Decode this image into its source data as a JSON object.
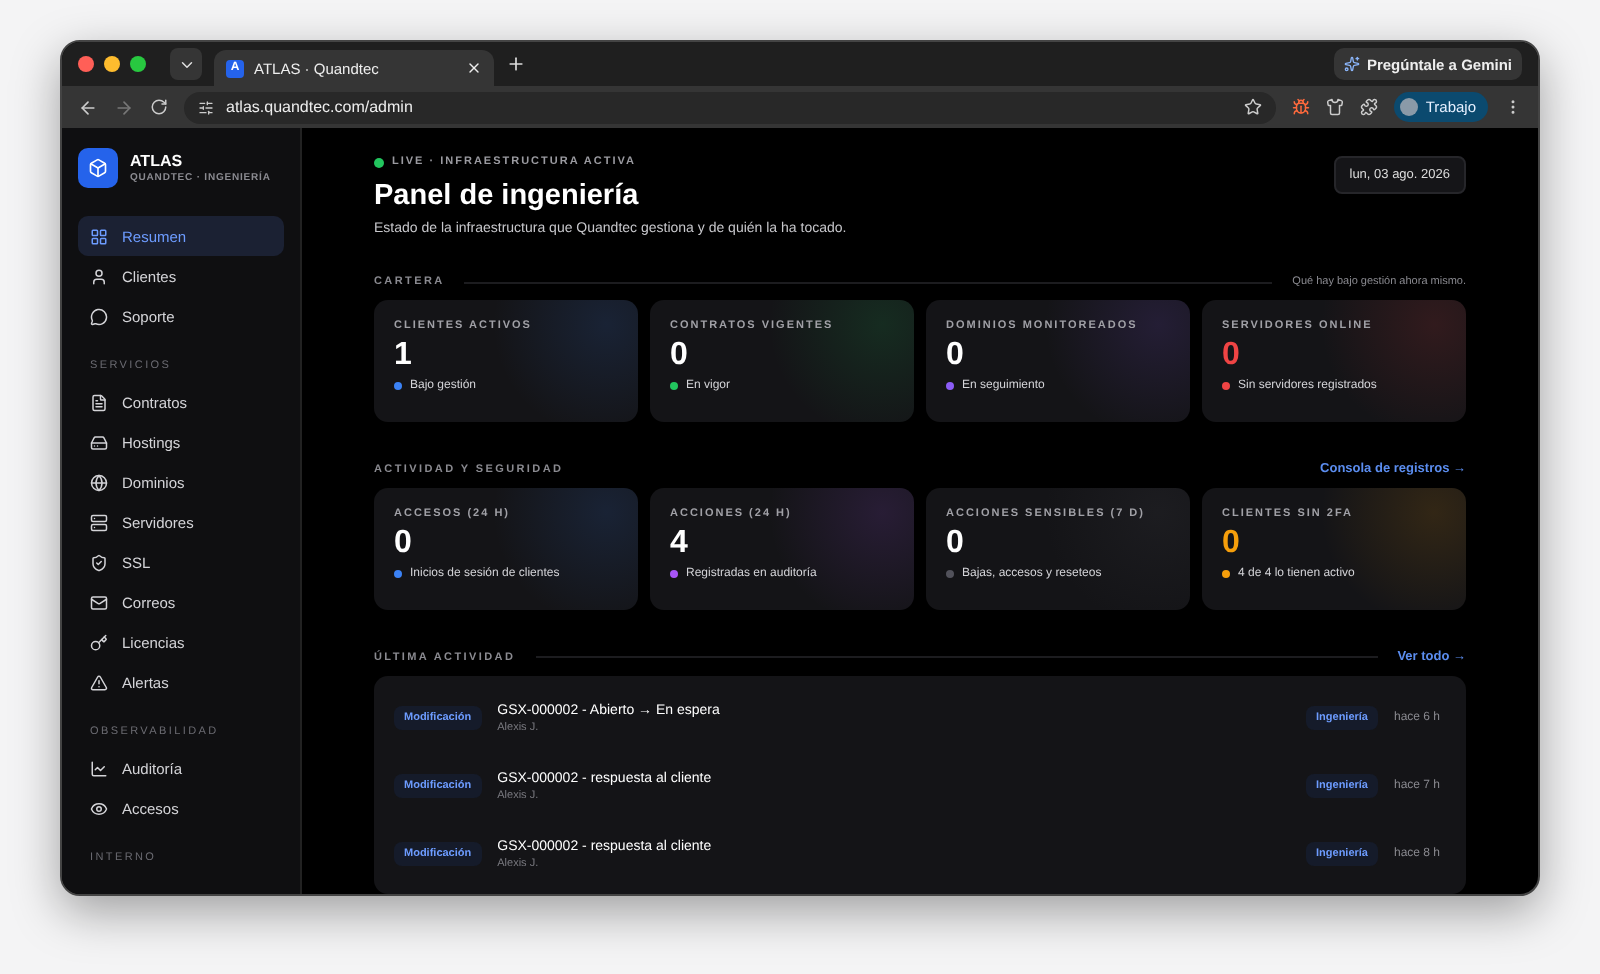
{
  "browser": {
    "tab_title": "ATLAS · Quandtec",
    "tab_favicon": "A",
    "gemini_button": "Pregúntale a Gemini",
    "url": "atlas.quandtec.com/admin",
    "profile": "Trabajo"
  },
  "sidebar": {
    "brand": {
      "name": "ATLAS",
      "subtitle": "QUANDTEC · INGENIERÍA"
    },
    "sections": [
      {
        "items": [
          {
            "label": "Resumen",
            "selected": true
          },
          {
            "label": "Clientes",
            "selected": false
          },
          {
            "label": "Soporte",
            "selected": false
          }
        ]
      },
      {
        "heading": "SERVICIOS",
        "items": [
          {
            "label": "Contratos",
            "selected": false
          },
          {
            "label": "Hostings",
            "selected": false
          },
          {
            "label": "Dominios",
            "selected": false
          },
          {
            "label": "Servidores",
            "selected": false
          },
          {
            "label": "SSL",
            "selected": false
          },
          {
            "label": "Correos",
            "selected": false
          },
          {
            "label": "Licencias",
            "selected": false
          },
          {
            "label": "Alertas",
            "selected": false
          }
        ]
      },
      {
        "heading": "OBSERVABILIDAD",
        "items": [
          {
            "label": "Auditoría",
            "selected": false
          },
          {
            "label": "Accesos",
            "selected": false
          }
        ]
      },
      {
        "heading": "INTERNO"
      }
    ]
  },
  "header": {
    "status": "LIVE · INFRAESTRUCTURA ACTIVA",
    "title": "Panel de ingeniería",
    "subtitle": "Estado de la infraestructura que Quandtec gestiona y de quién la ha tocado.",
    "date": "lun, 03 ago. 2026"
  },
  "groups": [
    {
      "heading": "CARTERA",
      "note": "Qué hay bajo gestión ahora mismo.",
      "cards": [
        {
          "label": "CLIENTES ACTIVOS",
          "value": "1",
          "caption": "Bajo gestión",
          "color": "#3b82f6",
          "kind": "normal"
        },
        {
          "label": "CONTRATOS VIGENTES",
          "value": "0",
          "caption": "En vigor",
          "color": "#22c55e",
          "kind": "normal"
        },
        {
          "label": "DOMINIOS MONITOREADOS",
          "value": "0",
          "caption": "En seguimiento",
          "color": "#8b5cf6",
          "kind": "normal"
        },
        {
          "label": "SERVIDORES ONLINE",
          "value": "0",
          "caption": "Sin servidores registrados",
          "color": "#ef4444",
          "kind": "danger"
        }
      ]
    },
    {
      "heading": "ACTIVIDAD Y SEGURIDAD",
      "link": "Consola de registros →",
      "cards": [
        {
          "label": "ACCESOS (24 H)",
          "value": "0",
          "caption": "Inicios de sesión de clientes",
          "color": "#3b82f6",
          "kind": "normal"
        },
        {
          "label": "ACCIONES (24 H)",
          "value": "4",
          "caption": "Registradas en auditoría",
          "color": "#a855f7",
          "kind": "normal"
        },
        {
          "label": "ACCIONES SENSIBLES (7 D)",
          "value": "0",
          "caption": "Bajas, accesos y reseteos",
          "color": "#52525b",
          "kind": "normal"
        },
        {
          "label": "CLIENTES SIN 2FA",
          "value": "0",
          "caption": "4 de 4 lo tienen activo",
          "color": "#f59e0b",
          "kind": "warning"
        }
      ]
    }
  ],
  "activity": {
    "heading": "ÚLTIMA ACTIVIDAD",
    "link": "Ver todo →",
    "rows": [
      {
        "tag": "Modificación",
        "title": "GSX-000002 - Abierto → En espera",
        "author": "Alexis J.",
        "team": "Ingeniería",
        "time": "hace 6 h"
      },
      {
        "tag": "Modificación",
        "title": "GSX-000002 - respuesta al cliente",
        "author": "Alexis J.",
        "team": "Ingeniería",
        "time": "hace 7 h"
      },
      {
        "tag": "Modificación",
        "title": "GSX-000002 - respuesta al cliente",
        "author": "Alexis J.",
        "team": "Ingeniería",
        "time": "hace 8 h"
      }
    ]
  }
}
